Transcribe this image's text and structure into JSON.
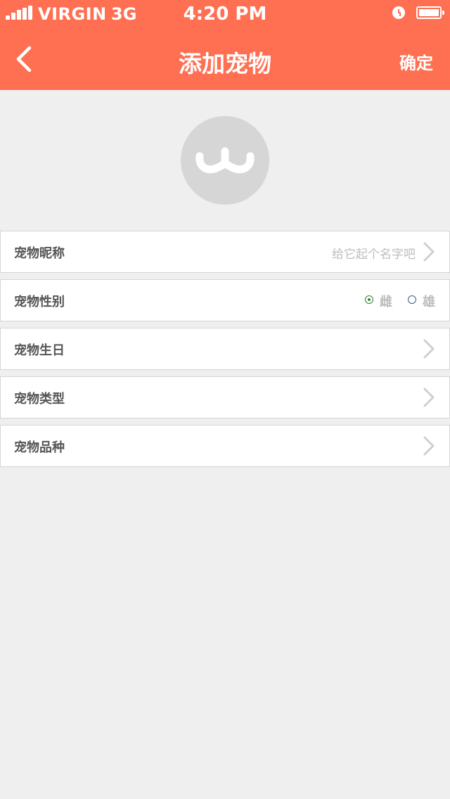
{
  "status_bar": {
    "carrier": "VIRGIN",
    "network": "3G",
    "time": "4:20 PM"
  },
  "nav": {
    "title": "添加宠物",
    "confirm_label": "确定"
  },
  "form": {
    "nickname": {
      "label": "宠物昵称",
      "placeholder": "给它起个名字吧"
    },
    "gender": {
      "label": "宠物性别",
      "options": [
        "雌",
        "雄"
      ],
      "selected": "雌"
    },
    "birthday": {
      "label": "宠物生日"
    },
    "type": {
      "label": "宠物类型"
    },
    "breed": {
      "label": "宠物品种"
    }
  },
  "colors": {
    "accent": "#ff6f52",
    "background": "#efefef"
  }
}
